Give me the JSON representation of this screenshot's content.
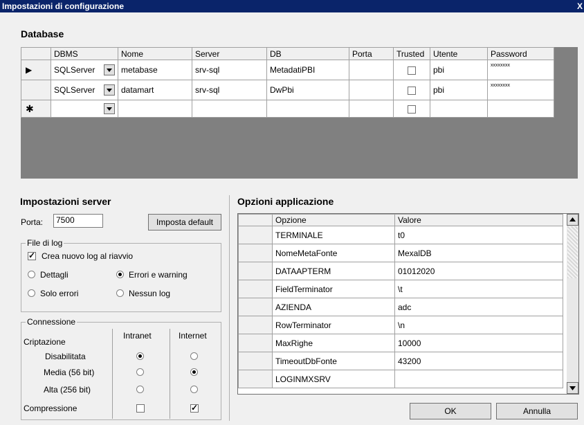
{
  "window": {
    "title": "Impostazioni di configurazione",
    "close_glyph": "X"
  },
  "database": {
    "title": "Database",
    "columns": [
      "DBMS",
      "Nome",
      "Server",
      "DB",
      "Porta",
      "Trusted",
      "Utente",
      "Password"
    ],
    "rows": [
      {
        "marker": "▶",
        "dbms": "SQLServer",
        "nome": "metabase",
        "server": "srv-sql",
        "db": "MetadatiPBI",
        "porta": "",
        "trusted": false,
        "utente": "pbi",
        "password": "xxxxxxxx"
      },
      {
        "marker": "",
        "dbms": "SQLServer",
        "nome": "datamart",
        "server": "srv-sql",
        "db": "DwPbi",
        "porta": "",
        "trusted": false,
        "utente": "pbi",
        "password": "xxxxxxxx"
      },
      {
        "marker": "✱",
        "dbms": "",
        "nome": "",
        "server": "",
        "db": "",
        "porta": "",
        "trusted": false,
        "utente": "",
        "password": ""
      }
    ]
  },
  "server": {
    "title": "Impostazioni server",
    "porta_label": "Porta:",
    "porta_value": "7500",
    "default_button": "Imposta default",
    "log_group": "File di log",
    "crea_log": "Crea nuovo log al riavvio",
    "crea_log_checked": true,
    "dettagli": "Dettagli",
    "errori_warning": "Errori e warning",
    "solo_errori": "Solo errori",
    "nessun_log": "Nessun log",
    "log_selected": "errori_warning",
    "conn_group": "Connessione",
    "intranet": "Intranet",
    "internet": "Internet",
    "criptazione": "Criptazione",
    "disabilitata": "Disabilitata",
    "media": "Media (56 bit)",
    "alta": "Alta (256 bit)",
    "compressione": "Compressione",
    "intranet_selected": "disabilitata",
    "internet_selected": "media",
    "compressione_intranet": false,
    "compressione_internet": true
  },
  "options": {
    "title": "Opzioni applicazione",
    "col_opzione": "Opzione",
    "col_valore": "Valore",
    "rows": [
      {
        "opzione": "TERMINALE",
        "valore": "t0"
      },
      {
        "opzione": "NomeMetaFonte",
        "valore": "MexalDB"
      },
      {
        "opzione": "DATAAPTERM",
        "valore": "01012020"
      },
      {
        "opzione": "FieldTerminator",
        "valore": "\\t"
      },
      {
        "opzione": "AZIENDA",
        "valore": "adc"
      },
      {
        "opzione": "RowTerminator",
        "valore": "\\n"
      },
      {
        "opzione": "MaxRighe",
        "valore": "10000"
      },
      {
        "opzione": "TimeoutDbFonte",
        "valore": "43200"
      },
      {
        "opzione": "LOGINMXSRV",
        "valore": ""
      }
    ]
  },
  "buttons": {
    "ok": "OK",
    "annulla": "Annulla"
  }
}
